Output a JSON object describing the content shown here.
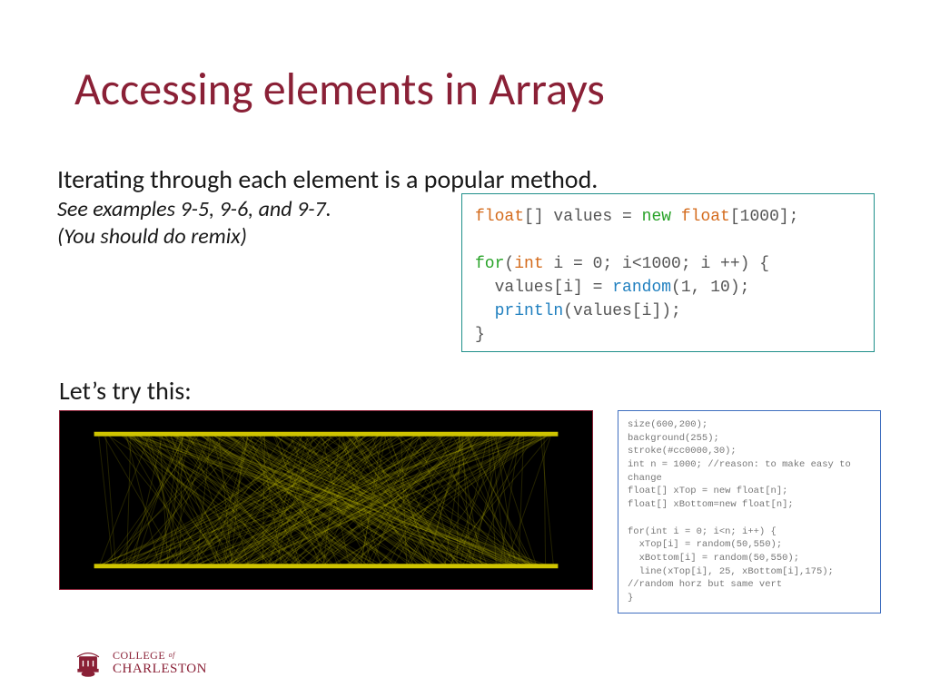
{
  "title": "Accessing elements in Arrays",
  "subtitle": "Iterating through each element is a popular method.",
  "note_line1": "See examples 9-5, 9-6, and 9-7.",
  "note_line2": "(You should do remix)",
  "lets_try": "Let’s try this:",
  "tokens": {
    "float_arr": "float",
    "values_decl": "[] values = ",
    "new": "new",
    "float_sz": " float",
    "arr_sz": "[1000];",
    "for": "for",
    "int": "int",
    "for_sig": " i = 0; i<1000; i ++) {",
    "body1a": "  values[i] = ",
    "random": "random",
    "body1b": "(1, 10);",
    "body2a": "  ",
    "println": "println",
    "body2b": "(values[i]);",
    "close": "}"
  },
  "code2": "size(600,200);\nbackground(255);\nstroke(#cc0000,30);\nint n = 1000; //reason: to make easy to change\nfloat[] xTop = new float[n];\nfloat[] xBottom=new float[n];\n\nfor(int i = 0; i<n; i++) {\n  xTop[i] = random(50,550);\n  xBottom[i] = random(50,550);\n  line(xTop[i], 25, xBottom[i],175);\n//random horz but same vert\n}",
  "logo": {
    "line1": "COLLEGE",
    "of": "of",
    "line2": "CHARLESTON"
  }
}
